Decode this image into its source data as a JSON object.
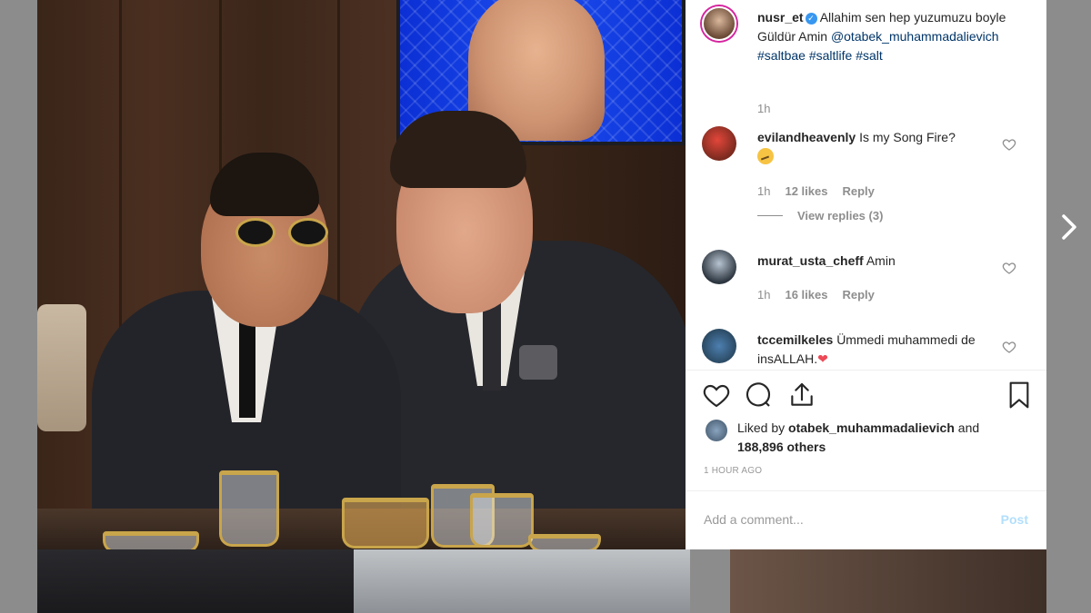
{
  "post": {
    "author": "nusr_et",
    "caption_text": "Allahim sen hep yuzumuzu boyle Güldür Amin",
    "caption_mention": "@otabek_muhammadalievich",
    "caption_tags": [
      "#saltbae",
      "#saltlife",
      "#salt"
    ],
    "caption_time": "1h"
  },
  "comments": [
    {
      "user": "evilandheavenly",
      "text": "Is my Song Fire?",
      "emoji": "thinking-face",
      "time": "1h",
      "likes": "12 likes",
      "reply_label": "Reply",
      "view_replies": "View replies (3)"
    },
    {
      "user": "murat_usta_cheff",
      "text": "Amin",
      "time": "1h",
      "likes": "16 likes",
      "reply_label": "Reply"
    },
    {
      "user": "tccemilkeles",
      "text": "Ümmedi muhammedi de insALLAH.",
      "emoji": "red-heart"
    }
  ],
  "likes": {
    "prefix": "Liked by",
    "user": "otabek_muhammadalievich",
    "conjunction": "and",
    "others": "188,896 others"
  },
  "time_ago": "1 HOUR AGO",
  "add_comment_placeholder": "Add a comment...",
  "post_button": "Post",
  "icons": [
    "heart-icon",
    "comment-icon",
    "share-icon",
    "bookmark-icon",
    "verified-badge-icon",
    "next-arrow-icon"
  ],
  "colors": {
    "link": "#003569",
    "muted": "#8e8e8e",
    "post_disabled": "#b2dffc",
    "verified": "#3897f0",
    "story_ring": "#d6249f"
  }
}
